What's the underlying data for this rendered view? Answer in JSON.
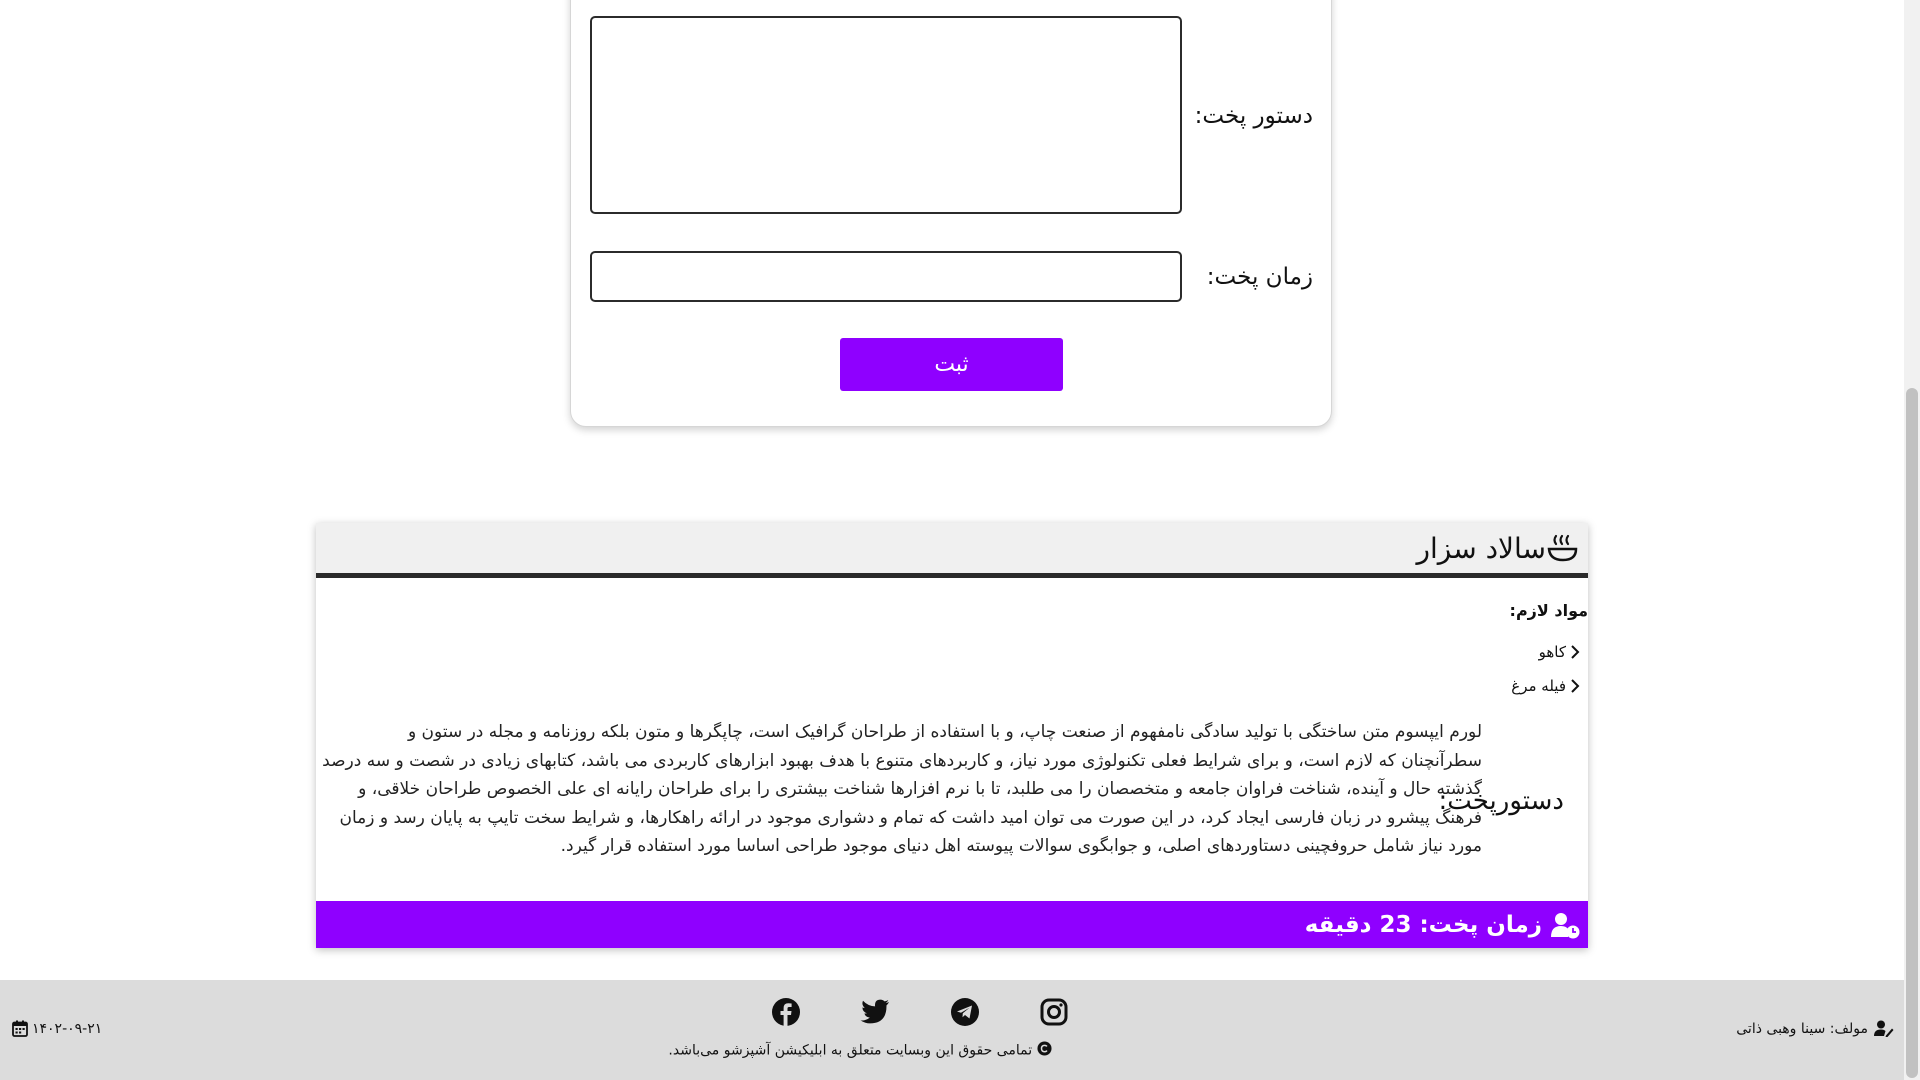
{
  "form": {
    "instructions_label": "دستور پخت:",
    "cook_time_label": "زمان پخت:",
    "instructions_value": "",
    "cook_time_value": "",
    "submit_label": "ثبت"
  },
  "recipe": {
    "title": "سالاد سزار",
    "ingredients_heading": "مواد لازم:",
    "ingredients": [
      "کاهو",
      "فیله مرغ"
    ],
    "instructions_label": "دستورپخت:",
    "instructions_text": "لورم ایپسوم متن ساختگی با تولید سادگی نامفهوم از صنعت چاپ، و با استفاده از طراحان گرافیک است، چاپگرها و متون بلکه روزنامه و مجله در ستون و سطرآنچنان که لازم است، و برای شرایط فعلی تکنولوژی مورد نیاز، و کاربردهای متنوع با هدف بهبود ابزارهای کاربردی می باشد، کتابهای زیادی در شصت و سه درصد گذشته حال و آینده، شناخت فراوان جامعه و متخصصان را می طلبد، تا با نرم افزارها شناخت بیشتری را برای طراحان رایانه ای علی الخصوص طراحان خلاقی، و فرهنگ پیشرو در زبان فارسی ایجاد کرد، در این صورت می توان امید داشت که تمام و دشواری موجود در ارائه راهکارها، و شرایط سخت تایپ به پایان رسد و زمان مورد نیاز شامل حروفچینی دستاوردهای اصلی، و جوابگوی سوالات پیوسته اهل دنیای موجود طراحی اساسا مورد استفاده قرار گیرد.",
    "cook_time": "زمان پخت: 23 دقیقه"
  },
  "footer": {
    "copyright": "تمامی حقوق این وبسایت متعلق به ابلیکیشن آشپزشو می‌باشد.",
    "author": "مولف: سینا وهبی ذاتی",
    "date": "۱۴۰۲-۰۹-۲۱",
    "socials": [
      "facebook-icon",
      "twitter-icon",
      "telegram-icon",
      "instagram-icon"
    ]
  },
  "colors": {
    "accent": "#8f00ff",
    "footer_bg": "#dcdcdc",
    "header_bg": "#f0f0f0"
  }
}
